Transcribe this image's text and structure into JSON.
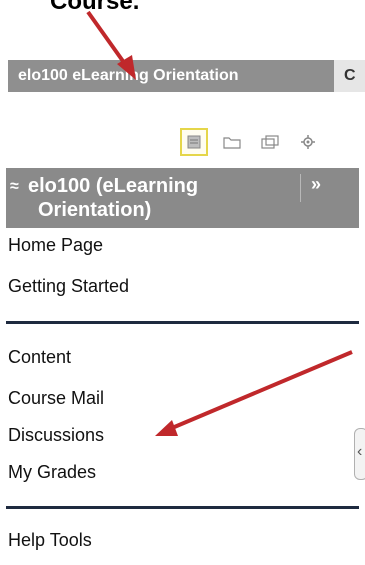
{
  "caption": {
    "text": "Course."
  },
  "course_tab": {
    "label": "elo100 eLearning Orientation",
    "next_tab_letter": "C"
  },
  "toolbar": {
    "icons": [
      "list-view-icon",
      "folder-icon",
      "window-icon",
      "gear-icon"
    ],
    "selected": "list-view-icon"
  },
  "panel": {
    "title_line1": "elo100 (eLearning",
    "title_line2": "Orientation)",
    "collapse_glyph": "≈",
    "expand_glyph": "»"
  },
  "menu": {
    "group1": [
      "Home Page",
      "Getting Started"
    ],
    "group2": [
      "Content",
      "Course Mail",
      "Discussions",
      "My Grades"
    ],
    "group3": [
      "Help Tools"
    ]
  },
  "side_handle": {
    "glyph": "‹"
  },
  "colors": {
    "tab_bg": "#8f8f8f",
    "panel_bg": "#8a8a8a",
    "separator": "#1e2a3f",
    "annotation_arrow": "#c0282b",
    "selected_border": "#e5d64a"
  }
}
